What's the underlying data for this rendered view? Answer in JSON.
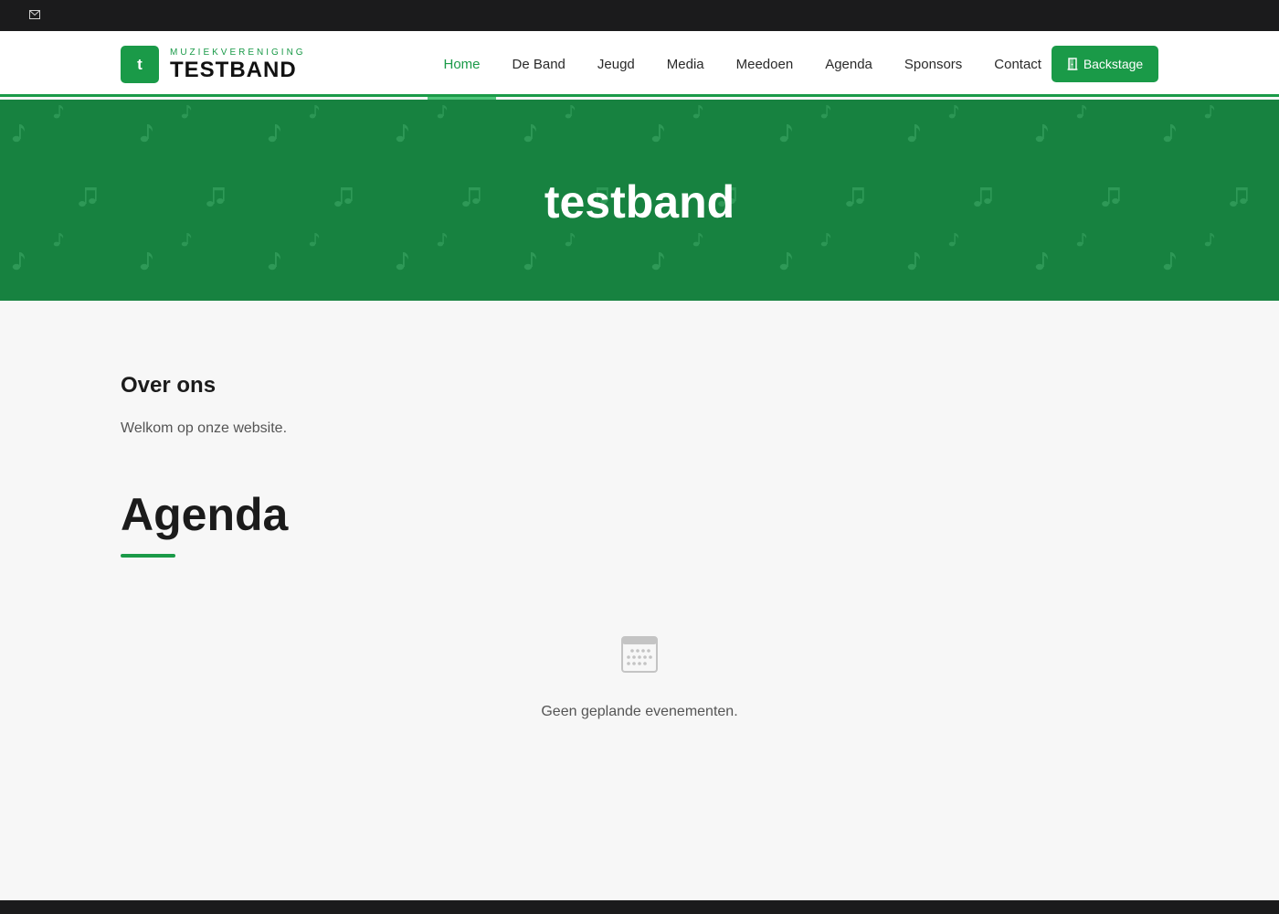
{
  "topbar": {
    "mail_icon": "envelope-icon"
  },
  "logo": {
    "initial": "t",
    "subtitle": "MUZIEKVERENIGING",
    "name": "TESTBAND"
  },
  "nav": {
    "items": [
      {
        "label": "Home",
        "active": true
      },
      {
        "label": "De Band",
        "active": false
      },
      {
        "label": "Jeugd",
        "active": false
      },
      {
        "label": "Media",
        "active": false
      },
      {
        "label": "Meedoen",
        "active": false
      },
      {
        "label": "Agenda",
        "active": false
      },
      {
        "label": "Sponsors",
        "active": false
      },
      {
        "label": "Contact",
        "active": false
      }
    ],
    "backstage_label": "Backstage",
    "backstage_icon": "door-icon"
  },
  "hero": {
    "title": "testband",
    "pattern_icon": "music-note-icon"
  },
  "about": {
    "title": "Over ons",
    "text": "Welkom op onze website."
  },
  "agenda": {
    "title": "Agenda",
    "empty_icon": "calendar-icon",
    "empty_text": "Geen geplande evenementen."
  },
  "colors": {
    "brand_green": "#1a9a48",
    "hero_green": "#178240",
    "dark": "#1b1b1c",
    "background": "#f7f7f7"
  }
}
